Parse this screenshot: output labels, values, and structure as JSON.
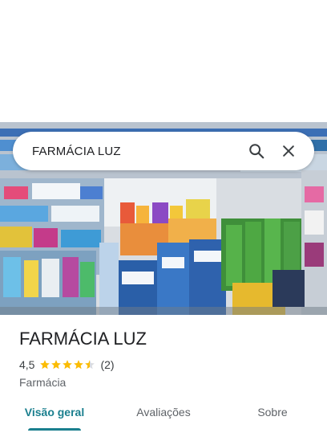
{
  "search": {
    "value": "FARMÁCIA LUZ"
  },
  "place": {
    "name": "FARMÁCIA LUZ",
    "rating": "4,5",
    "stars_value": 4.5,
    "review_count": "(2)",
    "category": "Farmácia"
  },
  "tabs": [
    {
      "label": "Visão geral",
      "active": true
    },
    {
      "label": "Avaliações",
      "active": false
    },
    {
      "label": "Sobre",
      "active": false
    }
  ],
  "colors": {
    "accent": "#1a7f8e",
    "star": "#fbbc04"
  },
  "icons": {
    "search": "search-icon",
    "close": "close-icon"
  }
}
